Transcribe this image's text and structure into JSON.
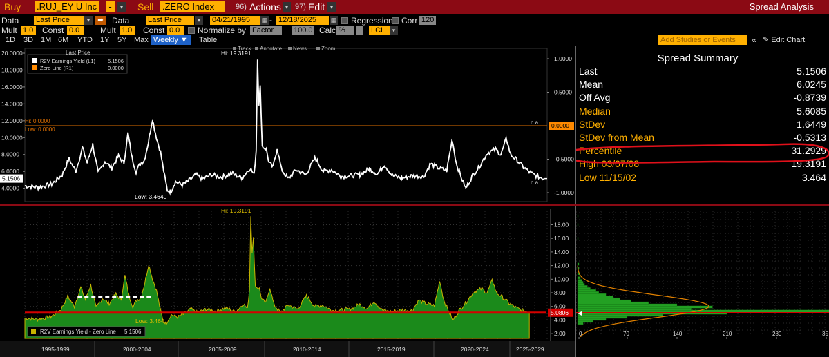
{
  "toolbar": {
    "buy_label": "Buy",
    "buy_ticker": ".RUJ_EY U Inc",
    "dash": "-",
    "sell_label": "Sell",
    "sell_ticker": ".ZERO Index",
    "actions_num": "96)",
    "actions_label": "Actions",
    "edit_num": "97)",
    "edit_label": "Edit",
    "title": "Spread Analysis"
  },
  "settings": {
    "data_label": "Data",
    "data1_value": "Last Price",
    "data2_label": "Data",
    "data2_value": "Last Price",
    "start_date": "04/21/1995",
    "date_sep": "-",
    "end_date": "12/18/2025",
    "regression_label": "Regression",
    "corr_label": "Corr",
    "corr_value": "120",
    "mult_label": "Mult",
    "mult1_value": "1.0",
    "const_label": "Const",
    "const1_value": "0.0",
    "mult2_label": "Mult",
    "mult2_value": "1.0",
    "const2_label": "Const",
    "const2_value": "0.0",
    "normalize_label": "Normalize by",
    "normalize_value": "Factor",
    "normalize_num": "100.0",
    "calc_label": "Calc",
    "calc_value": "%",
    "ccy_value": "LCL"
  },
  "periods": {
    "items": [
      "1D",
      "3D",
      "1M",
      "6M",
      "YTD",
      "1Y",
      "5Y",
      "Max"
    ],
    "freq": "Weekly",
    "table": "Table",
    "add_studies": "Add Studies or Events",
    "edit_chart": "Edit Chart"
  },
  "top_chart": {
    "legend_header": "Last Price",
    "legend1_label": "R2V Earnings Yield  (L1)",
    "legend1_value": "5.1506",
    "legend2_label": "Zero Line  (R1)",
    "legend2_value": "0.0000",
    "tools": [
      "Track",
      "Annotate",
      "News",
      "Zoom"
    ],
    "hi_label": "Hi: 19.3191",
    "low_label": "Low: 3.4640",
    "hi_left": "Hi: 0.0000",
    "low_left": "Low: 0.0000",
    "na1": "n.a.",
    "na2": "n.a.",
    "last_badge": "5.1506",
    "zero_badge": "0.0000",
    "y_left": [
      "20.0000",
      "18.0000",
      "16.0000",
      "14.0000",
      "12.0000",
      "10.0000",
      "8.0000",
      "6.0000",
      "4.0000"
    ],
    "y_right": [
      "1.0000",
      "0.5000",
      "-0.5000",
      "-1.0000"
    ]
  },
  "bottom_chart": {
    "hi_label": "Hi: 19.3191",
    "low_label": "Low: 3.464",
    "legend": "R2V Earnings Yield - Zero Line",
    "legend_value": "5.1506",
    "badge": "5.0806",
    "y_right": [
      "18.00",
      "16.00",
      "14.00",
      "12.00",
      "10.00",
      "8.00",
      "6.00",
      "4.00",
      "2.00"
    ],
    "x_labels": [
      "1995-1999",
      "2000-2004",
      "2005-2009",
      "2010-2014",
      "2015-2019",
      "2020-2024",
      "2025-2029"
    ]
  },
  "summary": {
    "title": "Spread Summary",
    "rows": [
      {
        "k": "Last",
        "v": "5.1506"
      },
      {
        "k": "Mean",
        "v": "6.0245"
      },
      {
        "k": "Off Avg",
        "v": "-0.8739"
      },
      {
        "k": "Median",
        "v": "5.6085"
      },
      {
        "k": "StDev",
        "v": "1.6449"
      },
      {
        "k": "StDev from Mean",
        "v": "-0.5313"
      },
      {
        "k": "Percentile",
        "v": "31.2929"
      },
      {
        "k": "High 03/07/08",
        "v": "19.3191"
      },
      {
        "k": "Low 11/15/02",
        "v": "3.464"
      }
    ]
  },
  "histogram": {
    "x_labels": [
      "0",
      "70",
      "140",
      "210",
      "280",
      "35"
    ]
  },
  "colors": {
    "header_bg": "#8b0a14",
    "amber": "#ffb000",
    "green_fill": "#1a8a1a",
    "red_line": "#d40000",
    "active_tab": "#1e62c8"
  }
}
